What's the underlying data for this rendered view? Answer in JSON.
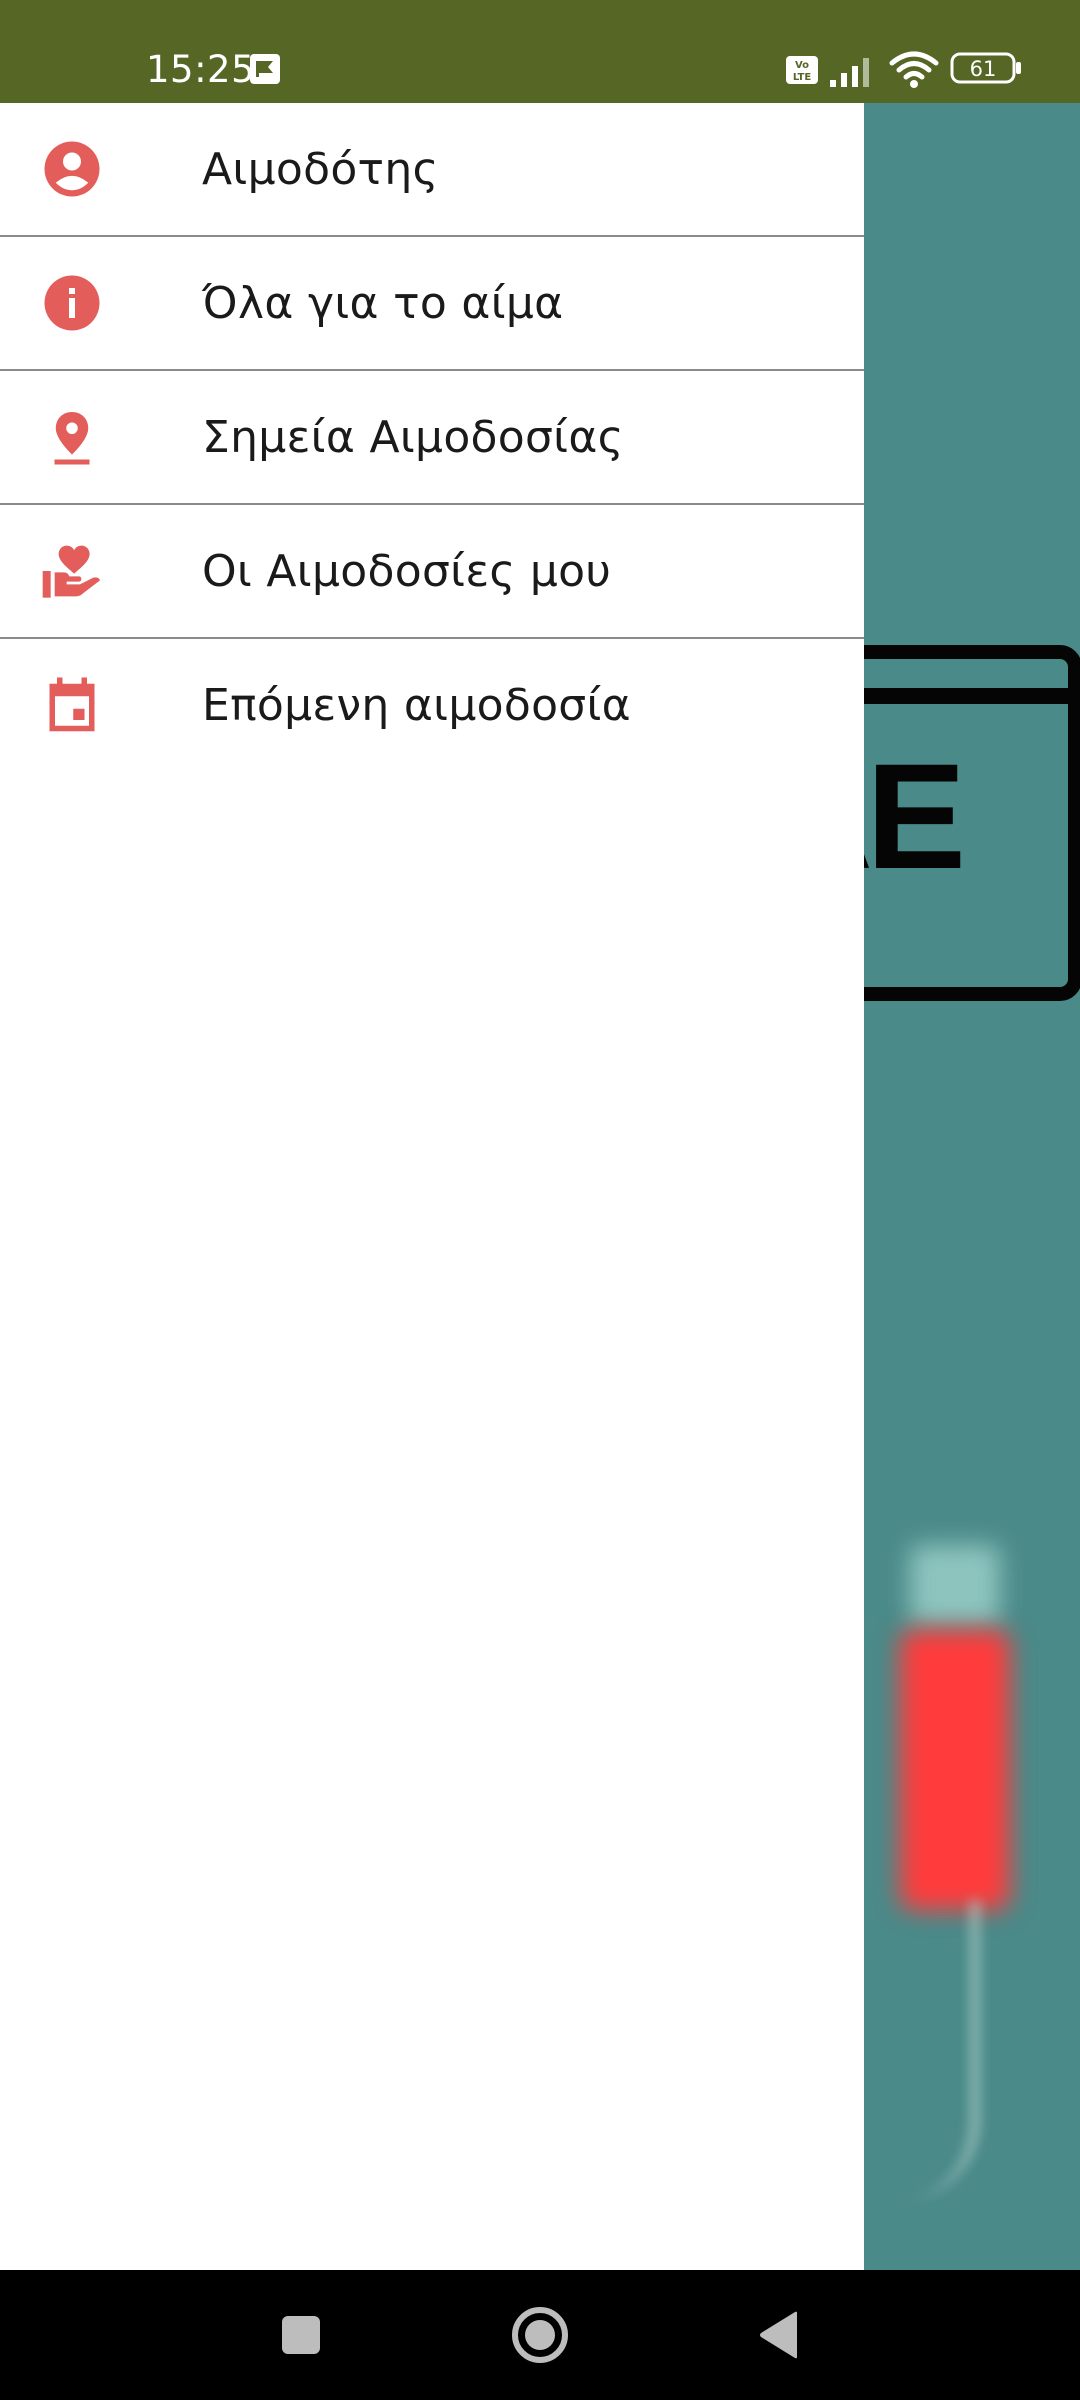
{
  "status_bar": {
    "time": "15:25",
    "battery": "61",
    "background_color": "#556625"
  },
  "drawer": {
    "items": [
      {
        "label": "Αιμοδότης",
        "icon": "account-circle-icon"
      },
      {
        "label": "Όλα για το αίμα",
        "icon": "info-icon"
      },
      {
        "label": "Σημεία Αιμοδοσίας",
        "icon": "location-pin-icon"
      },
      {
        "label": "Οι Αιμοδοσίες μου",
        "icon": "hand-heart-icon"
      },
      {
        "label": "Επόμενη αιμοδοσία",
        "icon": "calendar-event-icon"
      }
    ],
    "icon_color": "#e35d5b"
  },
  "background": {
    "color": "#4a8a89",
    "sign_text": "ΛΕ"
  },
  "nav_bar": {
    "buttons": [
      "recents",
      "home",
      "back"
    ]
  }
}
